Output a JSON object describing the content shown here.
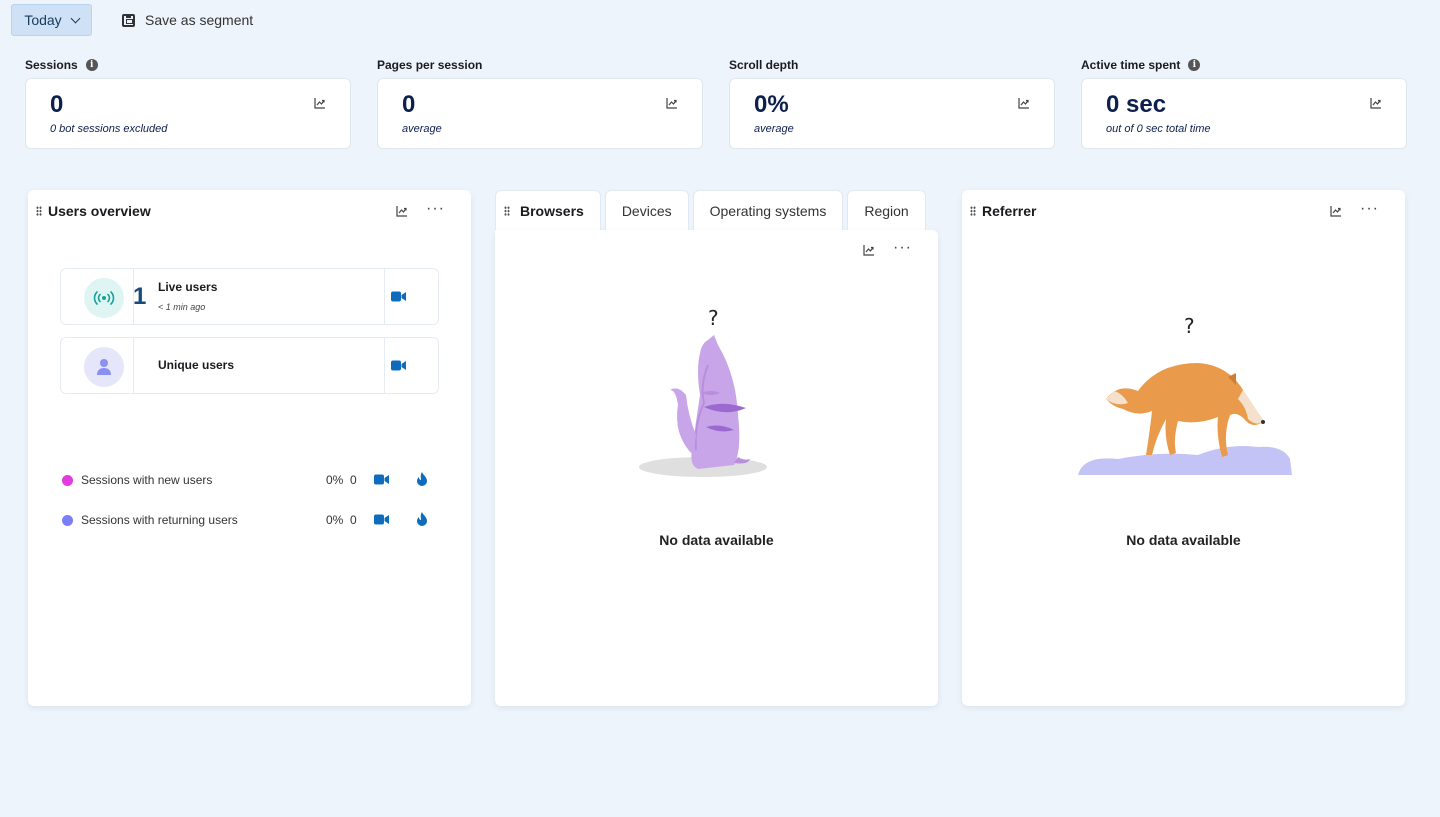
{
  "toolbar": {
    "date_range": "Today",
    "save_segment": "Save as segment"
  },
  "metrics": [
    {
      "title": "Sessions",
      "value": "0",
      "sub": "0 bot sessions excluded",
      "has_info": true
    },
    {
      "title": "Pages per session",
      "value": "0",
      "sub": "average",
      "has_info": false
    },
    {
      "title": "Scroll depth",
      "value": "0%",
      "sub": "average",
      "has_info": false
    },
    {
      "title": "Active time spent",
      "value": "0 sec",
      "sub": "out of 0 sec total time",
      "has_info": true
    }
  ],
  "users_overview": {
    "title": "Users overview",
    "live": {
      "count": "1",
      "label": "Live users",
      "sub": "< 1 min ago"
    },
    "unique": {
      "label": "Unique users"
    },
    "legend": [
      {
        "label": "Sessions with new users",
        "pct": "0%",
        "count": "0",
        "color": "#e13bde"
      },
      {
        "label": "Sessions with returning users",
        "pct": "0%",
        "count": "0",
        "color": "#7b7ff5"
      }
    ]
  },
  "tabs": [
    "Browsers",
    "Devices",
    "Operating systems",
    "Region"
  ],
  "browsers": {
    "empty": "No data available",
    "qmark": "?"
  },
  "referrer": {
    "title": "Referrer",
    "empty": "No data available",
    "qmark": "?"
  },
  "icons": {
    "info": "info-icon",
    "trend": "trend-chart-icon",
    "more": "more-dots-icon",
    "camera": "video-camera-icon",
    "heatmap": "flame-icon",
    "broadcast": "live-broadcast-icon",
    "user": "user-icon",
    "save": "floppy-disk-icon",
    "grip": "drag-grip-icon"
  },
  "colors": {
    "accent": "#0f6cbd",
    "value": "#0d1f4d"
  }
}
